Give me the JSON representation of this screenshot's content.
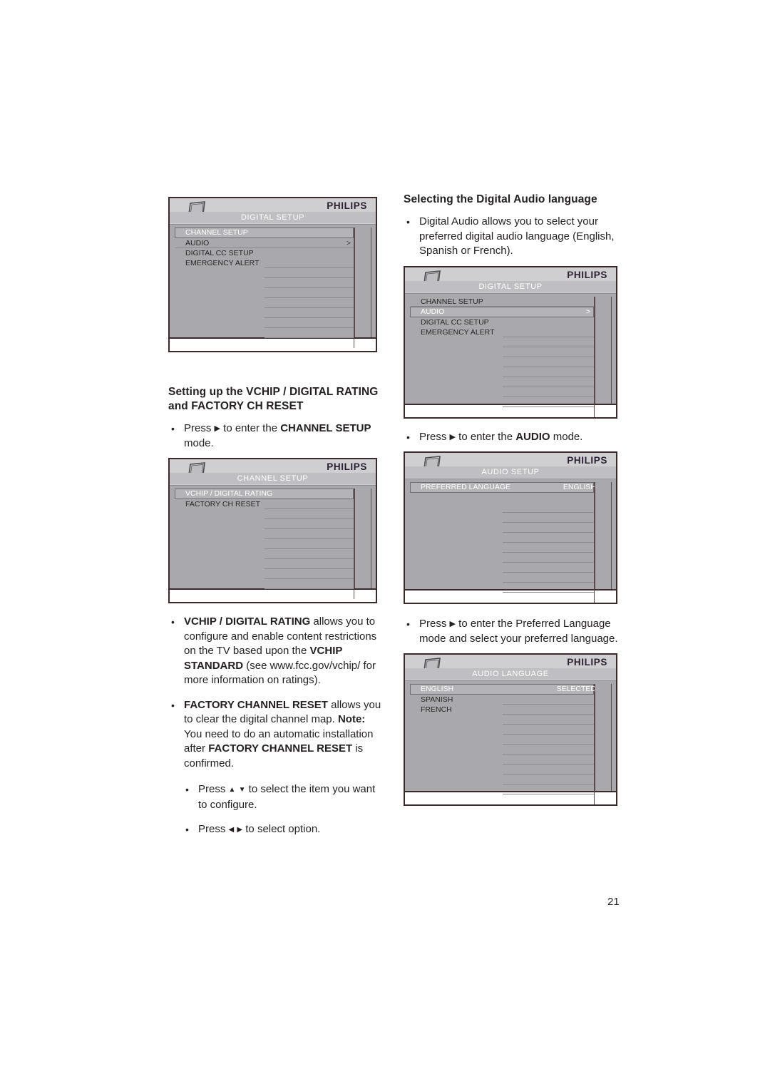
{
  "page": {
    "number": "21"
  },
  "left_column": {
    "osd_digital_setup": {
      "logo": "PHILIPS",
      "title": "DIGITAL SETUP",
      "tv_icon": "tv-icon",
      "rows": [
        {
          "label": "CHANNEL SETUP",
          "value": "",
          "selected": true
        },
        {
          "label": "AUDIO",
          "value": ">",
          "selected": false
        },
        {
          "label": "DIGITAL CC SETUP",
          "value": "",
          "selected": false
        },
        {
          "label": "EMERGENCY ALERT",
          "value": "",
          "selected": false
        },
        {
          "label": "",
          "value": "",
          "selected": false
        },
        {
          "label": "",
          "value": "",
          "selected": false
        },
        {
          "label": "",
          "value": "",
          "selected": false
        },
        {
          "label": "",
          "value": "",
          "selected": false
        },
        {
          "label": "",
          "value": "",
          "selected": false
        },
        {
          "label": "",
          "value": "",
          "selected": false
        },
        {
          "label": "",
          "value": "",
          "selected": false
        },
        {
          "label": "",
          "value": "",
          "selected": false
        }
      ]
    },
    "heading": "Setting up the VCHIP / DIGITAL RATING and FACTORY CH RESET",
    "bullet_channel_setup": {
      "dot": "•",
      "text_before": "Press ",
      "arrow": "▶",
      "text_mid": " to enter the ",
      "bold": "CHANNEL SETUP",
      "text_after": " mode."
    },
    "osd_channel_setup": {
      "logo": "PHILIPS",
      "title": "CHANNEL SETUP",
      "tv_icon": "tv-icon",
      "rows": [
        {
          "label": "VCHIP / DIGITAL RATING",
          "value": "",
          "selected": true
        },
        {
          "label": "FACTORY CH RESET",
          "value": "",
          "selected": false
        },
        {
          "label": "",
          "value": "",
          "selected": false
        },
        {
          "label": "",
          "value": "",
          "selected": false
        },
        {
          "label": "",
          "value": "",
          "selected": false
        },
        {
          "label": "",
          "value": "",
          "selected": false
        },
        {
          "label": "",
          "value": "",
          "selected": false
        },
        {
          "label": "",
          "value": "",
          "selected": false
        },
        {
          "label": "",
          "value": "",
          "selected": false
        },
        {
          "label": "",
          "value": "",
          "selected": false
        },
        {
          "label": "",
          "value": "",
          "selected": false
        },
        {
          "label": "",
          "value": "",
          "selected": false
        }
      ]
    },
    "bullet_vchip": {
      "dot": "•",
      "bold1": "VCHIP / DIGITAL RATING",
      "text1": " allows you to configure and enable content restrictions on the TV based upon the ",
      "bold2": "VCHIP STANDARD",
      "text2": " (see www.fcc.gov/vchip/ for more information on ratings)."
    },
    "bullet_factory": {
      "dot": "•",
      "bold1": "FACTORY CHANNEL RESET",
      "text1": " allows you to clear the digital channel map. ",
      "bold2": "Note:",
      "text2": " You need to do an automatic installation after ",
      "bold3": "FACTORY CHANNEL RESET",
      "text3": " is confirmed."
    },
    "bullet_select_item": {
      "dot": "•",
      "text_before": "Press ",
      "arrow_up": "▲",
      "arrow_down": "▼",
      "text_after": " to select the item you want to configure."
    },
    "bullet_select_option": {
      "dot": "•",
      "text_before": "Press ",
      "arrow_left": "◀",
      "arrow_right": "▶",
      "text_after": " to select option."
    }
  },
  "right_column": {
    "heading": "Selecting the Digital Audio language",
    "bullet_intro": {
      "dot": "•",
      "text": "Digital Audio allows you to select your preferred digital audio language (English, Spanish or French)."
    },
    "osd_digital_setup": {
      "logo": "PHILIPS",
      "title": "DIGITAL SETUP",
      "tv_icon": "tv-icon",
      "rows": [
        {
          "label": "CHANNEL SETUP",
          "value": "",
          "selected": false
        },
        {
          "label": "AUDIO",
          "value": ">",
          "selected": true
        },
        {
          "label": "DIGITAL CC SETUP",
          "value": "",
          "selected": false
        },
        {
          "label": "EMERGENCY ALERT",
          "value": "",
          "selected": false
        },
        {
          "label": "",
          "value": "",
          "selected": false
        },
        {
          "label": "",
          "value": "",
          "selected": false
        },
        {
          "label": "",
          "value": "",
          "selected": false
        },
        {
          "label": "",
          "value": "",
          "selected": false
        },
        {
          "label": "",
          "value": "",
          "selected": false
        },
        {
          "label": "",
          "value": "",
          "selected": false
        },
        {
          "label": "",
          "value": "",
          "selected": false
        },
        {
          "label": "",
          "value": "",
          "selected": false
        }
      ]
    },
    "bullet_audio": {
      "dot": "•",
      "text_before": "Press ",
      "arrow": "▶",
      "text_mid": " to enter the ",
      "bold": "AUDIO",
      "text_after": " mode."
    },
    "osd_audio_setup": {
      "logo": "PHILIPS",
      "title": "AUDIO SETUP",
      "tv_icon": "tv-icon",
      "rows": [
        {
          "label": "PREFERRED LANGUAGE",
          "value": "ENGLISH",
          "selected": true
        },
        {
          "label": "",
          "value": "",
          "selected": false
        },
        {
          "label": "",
          "value": "",
          "selected": false
        },
        {
          "label": "",
          "value": "",
          "selected": false
        },
        {
          "label": "",
          "value": "",
          "selected": false
        },
        {
          "label": "",
          "value": "",
          "selected": false
        },
        {
          "label": "",
          "value": "",
          "selected": false
        },
        {
          "label": "",
          "value": "",
          "selected": false
        },
        {
          "label": "",
          "value": "",
          "selected": false
        },
        {
          "label": "",
          "value": "",
          "selected": false
        },
        {
          "label": "",
          "value": "",
          "selected": false
        },
        {
          "label": "",
          "value": "",
          "selected": false
        }
      ]
    },
    "bullet_preferred": {
      "dot": "•",
      "text_before": "Press ",
      "arrow": "▶",
      "text_after": " to enter the Preferred Language mode and select your preferred language."
    },
    "osd_audio_language": {
      "logo": "PHILIPS",
      "title": "AUDIO LANGUAGE",
      "tv_icon": "tv-icon",
      "rows": [
        {
          "label": "ENGLISH",
          "value": "SELECTED",
          "selected": true
        },
        {
          "label": "SPANISH",
          "value": "",
          "selected": false
        },
        {
          "label": "FRENCH",
          "value": "",
          "selected": false
        },
        {
          "label": "",
          "value": "",
          "selected": false
        },
        {
          "label": "",
          "value": "",
          "selected": false
        },
        {
          "label": "",
          "value": "",
          "selected": false
        },
        {
          "label": "",
          "value": "",
          "selected": false
        },
        {
          "label": "",
          "value": "",
          "selected": false
        },
        {
          "label": "",
          "value": "",
          "selected": false
        },
        {
          "label": "",
          "value": "",
          "selected": false
        },
        {
          "label": "",
          "value": "",
          "selected": false
        },
        {
          "label": "",
          "value": "",
          "selected": false
        }
      ]
    }
  },
  "colors": {
    "osd_bg": "#a9a9ad",
    "osd_header": "#cfcfd2",
    "osd_title_bar": "#bfbfc3",
    "osd_border": "#3a2b2b",
    "text": "#231f20"
  }
}
